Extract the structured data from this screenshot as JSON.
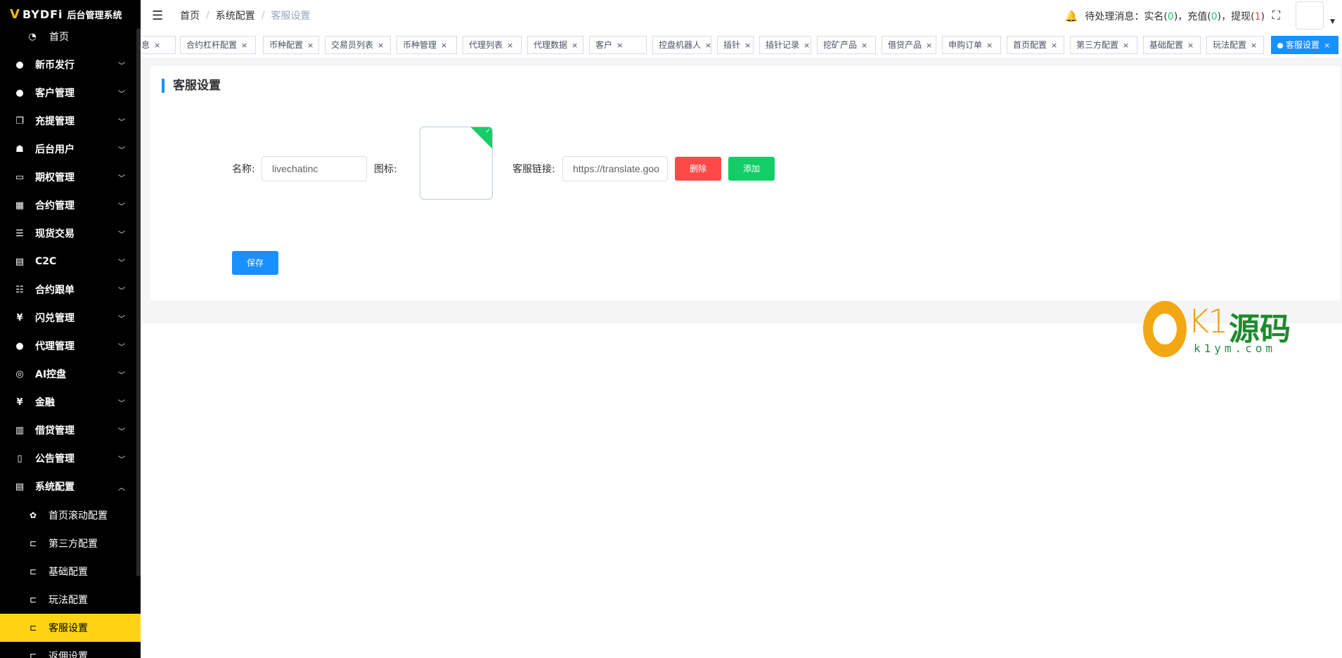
{
  "app": {
    "logo_mark": "V",
    "logo_brand": "BYDFi",
    "logo_subtitle": "后台管理系统"
  },
  "sidebar": {
    "home": "首页",
    "items": [
      {
        "label": "新币发行",
        "icon": "user-icon"
      },
      {
        "label": "客户管理",
        "icon": "user-icon"
      },
      {
        "label": "充提管理",
        "icon": "copy-icon"
      },
      {
        "label": "后台用户",
        "icon": "users-icon"
      },
      {
        "label": "期权管理",
        "icon": "monitor-icon"
      },
      {
        "label": "合约管理",
        "icon": "grid-icon"
      },
      {
        "label": "现货交易",
        "icon": "list-icon"
      },
      {
        "label": "C2C",
        "icon": "document-icon"
      },
      {
        "label": "合约跟单",
        "icon": "list-alt-icon"
      },
      {
        "label": "闪兑管理",
        "icon": "yen-icon"
      },
      {
        "label": "代理管理",
        "icon": "user-icon"
      },
      {
        "label": "AI控盘",
        "icon": "robot-icon"
      },
      {
        "label": "金融",
        "icon": "yen-icon"
      },
      {
        "label": "借贷管理",
        "icon": "book-icon"
      },
      {
        "label": "公告管理",
        "icon": "book-open-icon"
      },
      {
        "label": "系统配置",
        "icon": "document-icon"
      }
    ],
    "sub_items": [
      {
        "label": "首页滚动配置",
        "icon": "gear-icon"
      },
      {
        "label": "第三方配置",
        "icon": "tree-icon"
      },
      {
        "label": "基础配置",
        "icon": "tree-icon"
      },
      {
        "label": "玩法配置",
        "icon": "tree-icon"
      },
      {
        "label": "客服设置",
        "icon": "tree-icon"
      },
      {
        "label": "返佣设置",
        "icon": "tree-icon"
      }
    ]
  },
  "header": {
    "breadcrumb": [
      "首页",
      "系统配置",
      "客服设置"
    ],
    "notice_prefix": "待处理消息：",
    "notice_realname_label": "实名",
    "notice_realname_count": "0",
    "notice_deposit_label": "充值",
    "notice_deposit_count": "0",
    "notice_withdraw_label": "提现",
    "notice_withdraw_count": "1"
  },
  "tags": [
    {
      "label": "信息"
    },
    {
      "label": "合约杠杆配置"
    },
    {
      "label": "币种配置"
    },
    {
      "label": "交易员列表"
    },
    {
      "label": "币种管理"
    },
    {
      "label": "代理列表"
    },
    {
      "label": "代理数据"
    },
    {
      "label": "客户"
    },
    {
      "label": "控盘机器人"
    },
    {
      "label": "插针"
    },
    {
      "label": "插针记录"
    },
    {
      "label": "挖矿产品"
    },
    {
      "label": "借贷产品"
    },
    {
      "label": "申购订单"
    },
    {
      "label": "首页配置"
    },
    {
      "label": "第三方配置"
    },
    {
      "label": "基础配置"
    },
    {
      "label": "玩法配置"
    },
    {
      "label": "客服设置"
    }
  ],
  "tag_close": "×",
  "main": {
    "title": "客服设置",
    "name_label": "名称:",
    "name_value": "livechatinc",
    "icon_label": "图标:",
    "link_label": "客服链接:",
    "link_value": "https://translate.goo",
    "delete_button": "删除",
    "add_button": "添加",
    "save_button": "保存"
  },
  "watermark": {
    "brand": "K1",
    "brand_cn": "源码",
    "url": "k1ym.com"
  },
  "colors": {
    "accent": "#1890ff",
    "sidebar_active": "#ffd312",
    "danger": "#ff4949",
    "success": "#13ce66"
  }
}
